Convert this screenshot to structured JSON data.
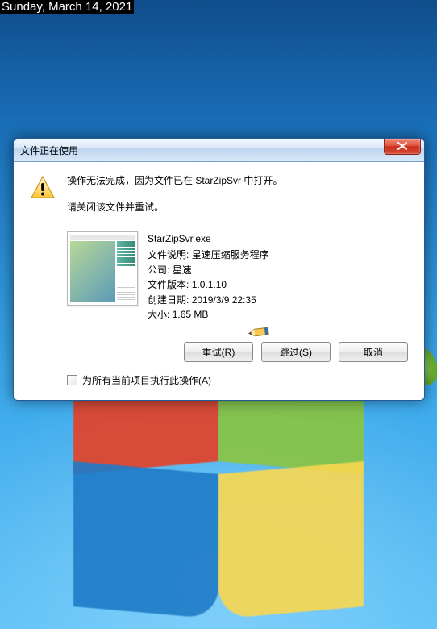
{
  "timestamp": "Sunday, March 14, 2021",
  "dialog": {
    "title": "文件正在使用",
    "message_line1": "操作无法完成，因为文件已在 StarZipSvr 中打开。",
    "message_line2": "请关闭该文件并重试。",
    "file": {
      "name": "StarZipSvr.exe",
      "desc_label": "文件说明:",
      "desc_value": "星速压缩服务程序",
      "company_label": "公司:",
      "company_value": "星速",
      "version_label": "文件版本:",
      "version_value": "1.0.1.10",
      "created_label": "创建日期:",
      "created_value": "2019/3/9 22:35",
      "size_label": "大小:",
      "size_value": "1.65 MB"
    },
    "buttons": {
      "retry": "重试(R)",
      "skip": "跳过(S)",
      "cancel": "取消"
    },
    "checkbox_label": "为所有当前项目执行此操作(A)"
  }
}
